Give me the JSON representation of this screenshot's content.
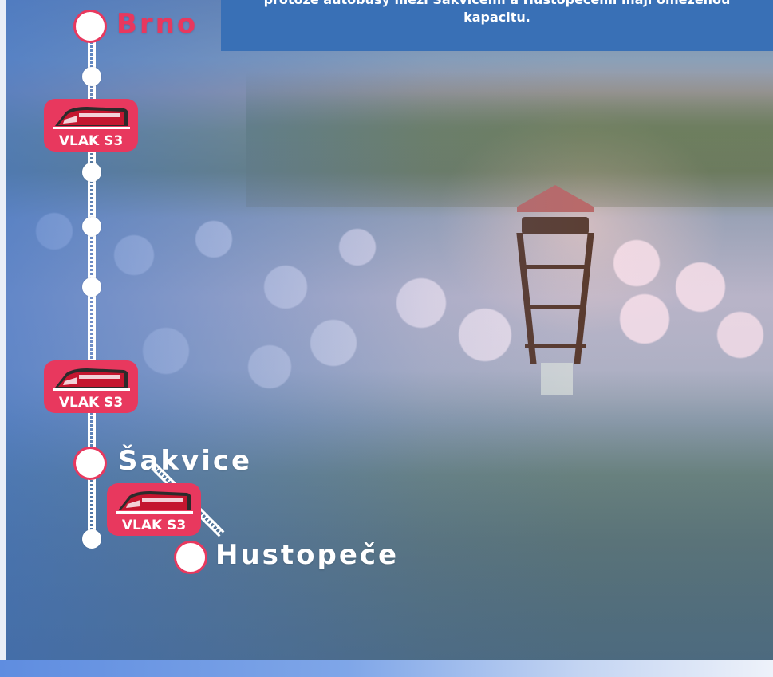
{
  "info": {
    "line1": "protože autobusy mezi Šakvicemi a Hustopečemi mají omezenou",
    "line2": "kapacitu."
  },
  "stations": {
    "brno": "Brno",
    "sakvice": "Šakvice",
    "hustopece": "Hustopeče"
  },
  "trains": [
    {
      "label": "VLAK S3",
      "icon": "train-icon"
    },
    {
      "label": "VLAK S3",
      "icon": "train-icon"
    },
    {
      "label": "VLAK S3",
      "icon": "train-icon"
    }
  ],
  "colors": {
    "accent": "#e8385e",
    "info_box": "#3970b6",
    "track": "#ffffff"
  }
}
